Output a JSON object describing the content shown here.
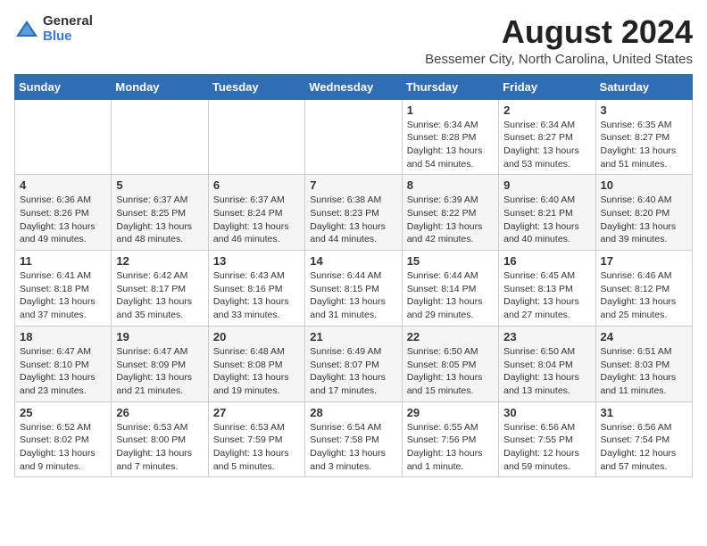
{
  "logo": {
    "general": "General",
    "blue": "Blue"
  },
  "title": "August 2024",
  "subtitle": "Bessemer City, North Carolina, United States",
  "headers": [
    "Sunday",
    "Monday",
    "Tuesday",
    "Wednesday",
    "Thursday",
    "Friday",
    "Saturday"
  ],
  "weeks": [
    [
      {
        "day": "",
        "sunrise": "",
        "sunset": "",
        "daylight": ""
      },
      {
        "day": "",
        "sunrise": "",
        "sunset": "",
        "daylight": ""
      },
      {
        "day": "",
        "sunrise": "",
        "sunset": "",
        "daylight": ""
      },
      {
        "day": "",
        "sunrise": "",
        "sunset": "",
        "daylight": ""
      },
      {
        "day": "1",
        "sunrise": "Sunrise: 6:34 AM",
        "sunset": "Sunset: 8:28 PM",
        "daylight": "Daylight: 13 hours and 54 minutes."
      },
      {
        "day": "2",
        "sunrise": "Sunrise: 6:34 AM",
        "sunset": "Sunset: 8:27 PM",
        "daylight": "Daylight: 13 hours and 53 minutes."
      },
      {
        "day": "3",
        "sunrise": "Sunrise: 6:35 AM",
        "sunset": "Sunset: 8:27 PM",
        "daylight": "Daylight: 13 hours and 51 minutes."
      }
    ],
    [
      {
        "day": "4",
        "sunrise": "Sunrise: 6:36 AM",
        "sunset": "Sunset: 8:26 PM",
        "daylight": "Daylight: 13 hours and 49 minutes."
      },
      {
        "day": "5",
        "sunrise": "Sunrise: 6:37 AM",
        "sunset": "Sunset: 8:25 PM",
        "daylight": "Daylight: 13 hours and 48 minutes."
      },
      {
        "day": "6",
        "sunrise": "Sunrise: 6:37 AM",
        "sunset": "Sunset: 8:24 PM",
        "daylight": "Daylight: 13 hours and 46 minutes."
      },
      {
        "day": "7",
        "sunrise": "Sunrise: 6:38 AM",
        "sunset": "Sunset: 8:23 PM",
        "daylight": "Daylight: 13 hours and 44 minutes."
      },
      {
        "day": "8",
        "sunrise": "Sunrise: 6:39 AM",
        "sunset": "Sunset: 8:22 PM",
        "daylight": "Daylight: 13 hours and 42 minutes."
      },
      {
        "day": "9",
        "sunrise": "Sunrise: 6:40 AM",
        "sunset": "Sunset: 8:21 PM",
        "daylight": "Daylight: 13 hours and 40 minutes."
      },
      {
        "day": "10",
        "sunrise": "Sunrise: 6:40 AM",
        "sunset": "Sunset: 8:20 PM",
        "daylight": "Daylight: 13 hours and 39 minutes."
      }
    ],
    [
      {
        "day": "11",
        "sunrise": "Sunrise: 6:41 AM",
        "sunset": "Sunset: 8:18 PM",
        "daylight": "Daylight: 13 hours and 37 minutes."
      },
      {
        "day": "12",
        "sunrise": "Sunrise: 6:42 AM",
        "sunset": "Sunset: 8:17 PM",
        "daylight": "Daylight: 13 hours and 35 minutes."
      },
      {
        "day": "13",
        "sunrise": "Sunrise: 6:43 AM",
        "sunset": "Sunset: 8:16 PM",
        "daylight": "Daylight: 13 hours and 33 minutes."
      },
      {
        "day": "14",
        "sunrise": "Sunrise: 6:44 AM",
        "sunset": "Sunset: 8:15 PM",
        "daylight": "Daylight: 13 hours and 31 minutes."
      },
      {
        "day": "15",
        "sunrise": "Sunrise: 6:44 AM",
        "sunset": "Sunset: 8:14 PM",
        "daylight": "Daylight: 13 hours and 29 minutes."
      },
      {
        "day": "16",
        "sunrise": "Sunrise: 6:45 AM",
        "sunset": "Sunset: 8:13 PM",
        "daylight": "Daylight: 13 hours and 27 minutes."
      },
      {
        "day": "17",
        "sunrise": "Sunrise: 6:46 AM",
        "sunset": "Sunset: 8:12 PM",
        "daylight": "Daylight: 13 hours and 25 minutes."
      }
    ],
    [
      {
        "day": "18",
        "sunrise": "Sunrise: 6:47 AM",
        "sunset": "Sunset: 8:10 PM",
        "daylight": "Daylight: 13 hours and 23 minutes."
      },
      {
        "day": "19",
        "sunrise": "Sunrise: 6:47 AM",
        "sunset": "Sunset: 8:09 PM",
        "daylight": "Daylight: 13 hours and 21 minutes."
      },
      {
        "day": "20",
        "sunrise": "Sunrise: 6:48 AM",
        "sunset": "Sunset: 8:08 PM",
        "daylight": "Daylight: 13 hours and 19 minutes."
      },
      {
        "day": "21",
        "sunrise": "Sunrise: 6:49 AM",
        "sunset": "Sunset: 8:07 PM",
        "daylight": "Daylight: 13 hours and 17 minutes."
      },
      {
        "day": "22",
        "sunrise": "Sunrise: 6:50 AM",
        "sunset": "Sunset: 8:05 PM",
        "daylight": "Daylight: 13 hours and 15 minutes."
      },
      {
        "day": "23",
        "sunrise": "Sunrise: 6:50 AM",
        "sunset": "Sunset: 8:04 PM",
        "daylight": "Daylight: 13 hours and 13 minutes."
      },
      {
        "day": "24",
        "sunrise": "Sunrise: 6:51 AM",
        "sunset": "Sunset: 8:03 PM",
        "daylight": "Daylight: 13 hours and 11 minutes."
      }
    ],
    [
      {
        "day": "25",
        "sunrise": "Sunrise: 6:52 AM",
        "sunset": "Sunset: 8:02 PM",
        "daylight": "Daylight: 13 hours and 9 minutes."
      },
      {
        "day": "26",
        "sunrise": "Sunrise: 6:53 AM",
        "sunset": "Sunset: 8:00 PM",
        "daylight": "Daylight: 13 hours and 7 minutes."
      },
      {
        "day": "27",
        "sunrise": "Sunrise: 6:53 AM",
        "sunset": "Sunset: 7:59 PM",
        "daylight": "Daylight: 13 hours and 5 minutes."
      },
      {
        "day": "28",
        "sunrise": "Sunrise: 6:54 AM",
        "sunset": "Sunset: 7:58 PM",
        "daylight": "Daylight: 13 hours and 3 minutes."
      },
      {
        "day": "29",
        "sunrise": "Sunrise: 6:55 AM",
        "sunset": "Sunset: 7:56 PM",
        "daylight": "Daylight: 13 hours and 1 minute."
      },
      {
        "day": "30",
        "sunrise": "Sunrise: 6:56 AM",
        "sunset": "Sunset: 7:55 PM",
        "daylight": "Daylight: 12 hours and 59 minutes."
      },
      {
        "day": "31",
        "sunrise": "Sunrise: 6:56 AM",
        "sunset": "Sunset: 7:54 PM",
        "daylight": "Daylight: 12 hours and 57 minutes."
      }
    ]
  ]
}
